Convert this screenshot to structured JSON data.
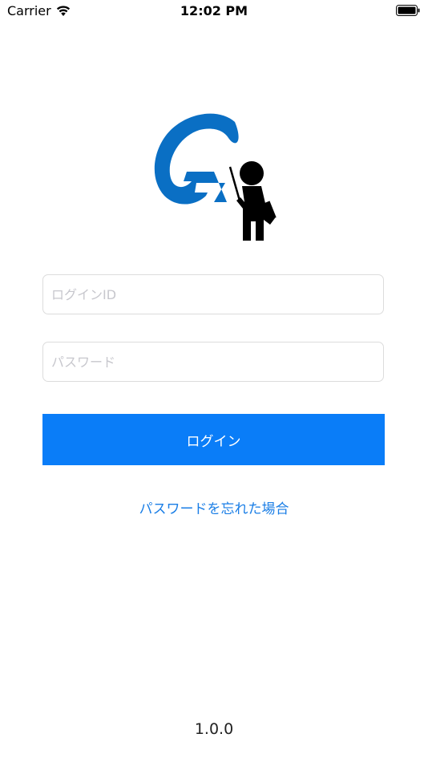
{
  "status_bar": {
    "carrier": "Carrier",
    "time": "12:02 PM",
    "wifi_icon": "wifi-icon",
    "battery_icon": "battery-icon"
  },
  "logo": {
    "icon": "g-teacher-logo-icon",
    "letter_color": "#0a6fc4",
    "figure_color": "#000000"
  },
  "login_form": {
    "id_placeholder": "ログインID",
    "id_value": "",
    "password_placeholder": "パスワード",
    "password_value": "",
    "login_label": "ログイン",
    "forgot_password_label": "パスワードを忘れた場合"
  },
  "footer": {
    "version": "1.0.0"
  },
  "colors": {
    "primary": "#0a7df8",
    "link": "#1a7ee6",
    "field_border": "#dcdcdc",
    "placeholder": "#c7c7cd"
  }
}
